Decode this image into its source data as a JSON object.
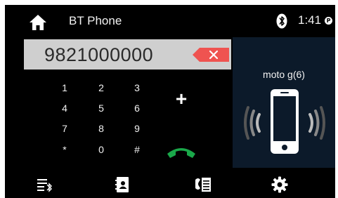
{
  "statusbar": {
    "title": "BT Phone",
    "time": "1:41",
    "badge": "P"
  },
  "dialer": {
    "number": "9821000000",
    "keys": [
      [
        "1",
        "2",
        "3"
      ],
      [
        "4",
        "5",
        "6"
      ],
      [
        "7",
        "8",
        "9"
      ],
      [
        "*",
        "0",
        "#"
      ]
    ],
    "plus_label": "+"
  },
  "device": {
    "name": "moto g(6)"
  },
  "colors": {
    "background": "#000000",
    "display_bg": "#cfcfcf",
    "backspace": "#ef5350",
    "call_green": "#1aa84a",
    "device_panel": "#0c1a2a"
  },
  "toolbar": {
    "items": [
      "bluetooth-list-icon",
      "contacts-icon",
      "call-log-icon",
      "settings-gear-icon"
    ]
  }
}
